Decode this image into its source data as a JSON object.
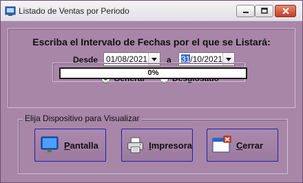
{
  "window": {
    "title": "Listado de Ventas por Periodo",
    "controls": [
      "minimize",
      "maximize",
      "close"
    ]
  },
  "form": {
    "heading": "Escriba el Intervalo de Fechas por el que se Listará:",
    "desde_label": "Desde",
    "a_label": "a",
    "fecha_desde": "01/08/2021",
    "fecha_hasta_day": "31",
    "fecha_hasta_rest": "/10/2021",
    "radio_general": "General",
    "radio_desglosado": "Desglosado",
    "selected_option": "General"
  },
  "progress": {
    "text": "0%",
    "value": 0
  },
  "device_group": {
    "legend": "Elija Dispositivo para Visualizar",
    "buttons": {
      "pantalla_first": "P",
      "pantalla_rest": "antalla",
      "impresora_first": "I",
      "impresora_rest": "mpresora",
      "cerrar_first": "C",
      "cerrar_rest": "errar"
    }
  },
  "colors": {
    "form_background": "#a886a8",
    "button_border": "#1f1fa8",
    "selection": "#3a70c7"
  }
}
